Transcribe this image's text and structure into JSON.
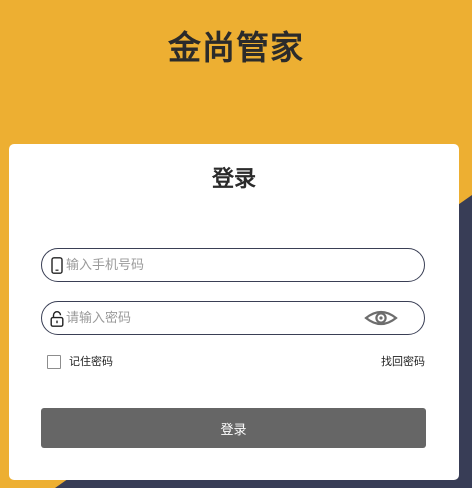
{
  "app": {
    "title": "金尚管家"
  },
  "login": {
    "title": "登录",
    "phone_placeholder": "输入手机号码",
    "phone_value": "",
    "password_placeholder": "请输入密码",
    "password_value": "",
    "remember_label": "记住密码",
    "remember_checked": false,
    "forgot_label": "找回密码",
    "submit_label": "登录"
  },
  "icons": {
    "phone": "phone-icon",
    "lock": "lock-icon",
    "eye": "eye-icon"
  },
  "colors": {
    "background_yellow": "#EDAF32",
    "background_navy": "#383D56",
    "card": "#FFFFFF",
    "button": "#666666",
    "title_text": "#2B2B2B",
    "field_border": "#3A3F55"
  }
}
